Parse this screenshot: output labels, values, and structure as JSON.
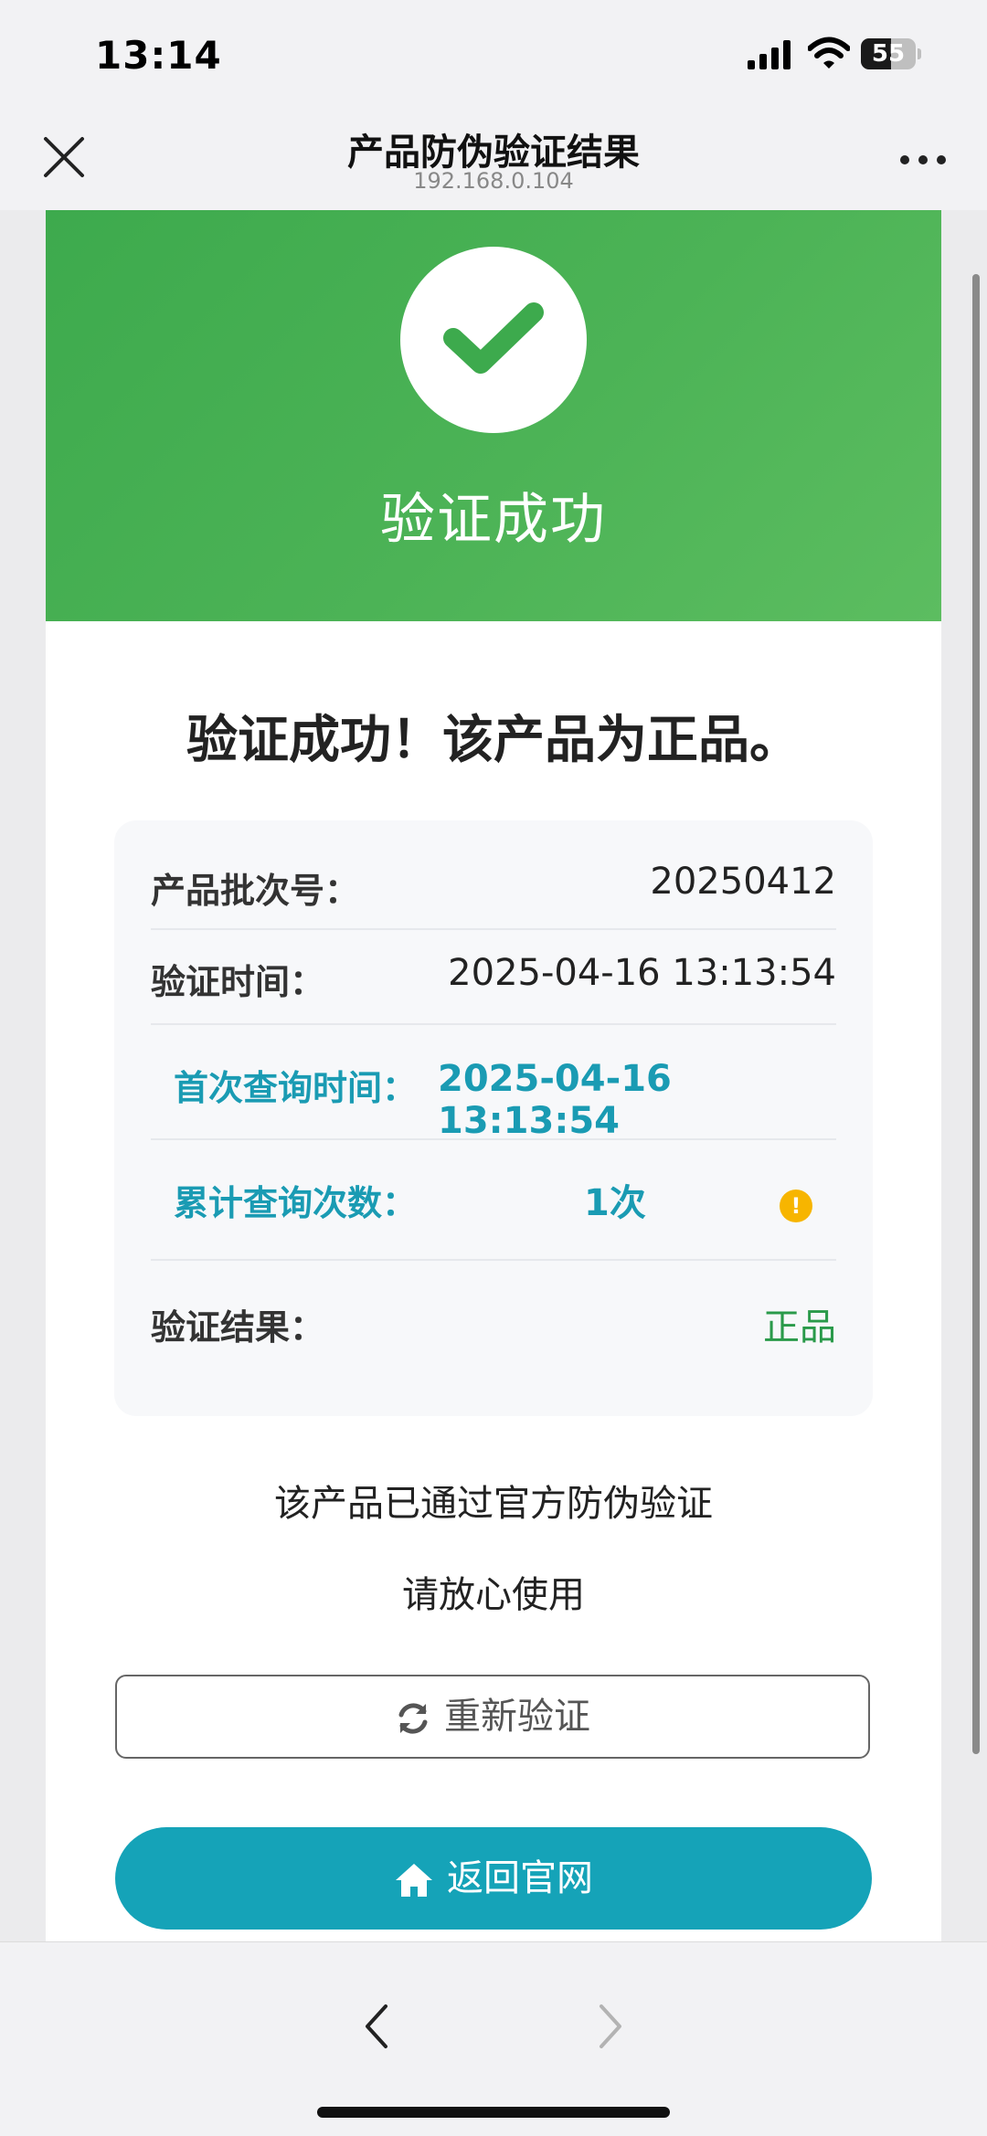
{
  "status_bar": {
    "time": "13:14",
    "battery_label": "55",
    "battery_level": 0.55,
    "icons": [
      "signal-icon",
      "wifi-icon",
      "battery-icon"
    ]
  },
  "nav": {
    "title": "产品防伪验证结果",
    "url": "192.168.0.104",
    "close_icon": "close-icon",
    "more_icon": "more-icon"
  },
  "hero": {
    "title": "验证成功",
    "icon": "check-icon",
    "color": "#4cb356"
  },
  "headline": "验证成功！该产品为正品。",
  "info": {
    "batch_label": "产品批次号：",
    "batch_value": "20250412",
    "verify_time_label": "验证时间：",
    "verify_time_value": "2025-04-16 13:13:54",
    "first_query_label": "首次查询时间：",
    "first_query_value": "2025-04-16 13:13:54",
    "count_label": "累计查询次数：",
    "count_value": "1次",
    "count_warn_icon": "warning-icon",
    "result_label": "验证结果：",
    "result_value": "正品"
  },
  "notes": {
    "line1": "该产品已通过官方防伪验证",
    "line2": "请放心使用"
  },
  "buttons": {
    "retry_label": "重新验证",
    "retry_icon": "refresh-icon",
    "home_label": "返回官网",
    "home_icon": "home-icon"
  },
  "colors": {
    "success_green": "#4cb356",
    "teal": "#1a9bb3",
    "result_green": "#2a9a4a",
    "warning": "#f7b500",
    "primary_button": "#15a3b8"
  },
  "toolbar": {
    "back_icon": "chevron-left-icon",
    "forward_icon": "chevron-right-icon"
  }
}
